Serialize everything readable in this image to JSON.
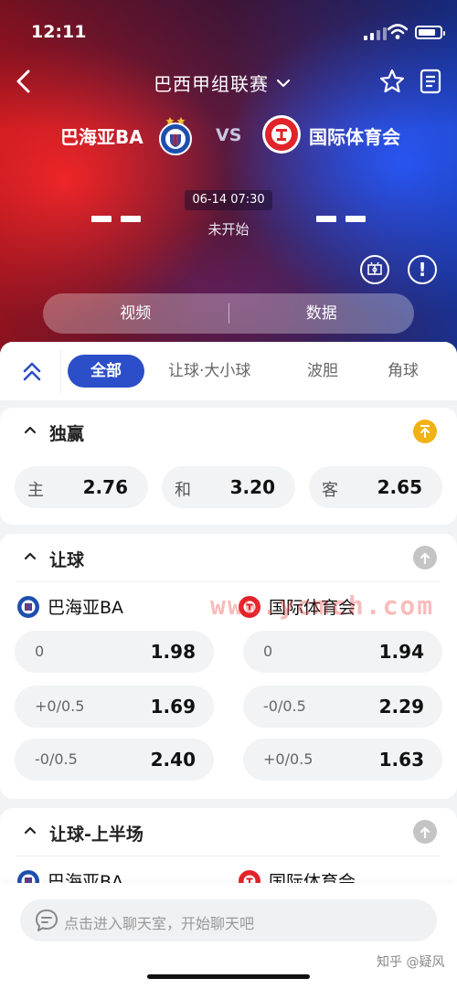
{
  "status_bar": {
    "time": "12:11"
  },
  "header": {
    "league": "巴西甲组联赛"
  },
  "match": {
    "home_team": "巴海亚BA",
    "away_team": "国际体育会",
    "vs": "VS",
    "datetime": "06-14  07:30",
    "status": "未开始"
  },
  "toggle": {
    "video": "视频",
    "data": "数据"
  },
  "tabs": [
    "全部",
    "让球·大小球",
    "波胆",
    "角球"
  ],
  "markets": {
    "win": {
      "title": "独赢",
      "home_label": "主",
      "home_odds": "2.76",
      "draw_label": "和",
      "draw_odds": "3.20",
      "away_label": "客",
      "away_odds": "2.65"
    },
    "handicap": {
      "title": "让球",
      "rows": [
        {
          "home_line": "0",
          "home_odds": "1.98",
          "away_line": "0",
          "away_odds": "1.94"
        },
        {
          "home_line": "+0/0.5",
          "home_odds": "1.69",
          "away_line": "-0/0.5",
          "away_odds": "2.29"
        },
        {
          "home_line": "-0/0.5",
          "home_odds": "2.40",
          "away_line": "+0/0.5",
          "away_odds": "1.63"
        }
      ]
    },
    "handicap_first_half": {
      "title": "让球-上半场"
    }
  },
  "watermark": "www.ycmch.com",
  "chat": {
    "placeholder": "点击进入聊天室，开始聊天吧"
  },
  "credit": "知乎 @疑风",
  "colors": {
    "accent": "#2c4ec8",
    "pin_active": "#f2b214",
    "pin_inactive": "#c4c4c4"
  }
}
